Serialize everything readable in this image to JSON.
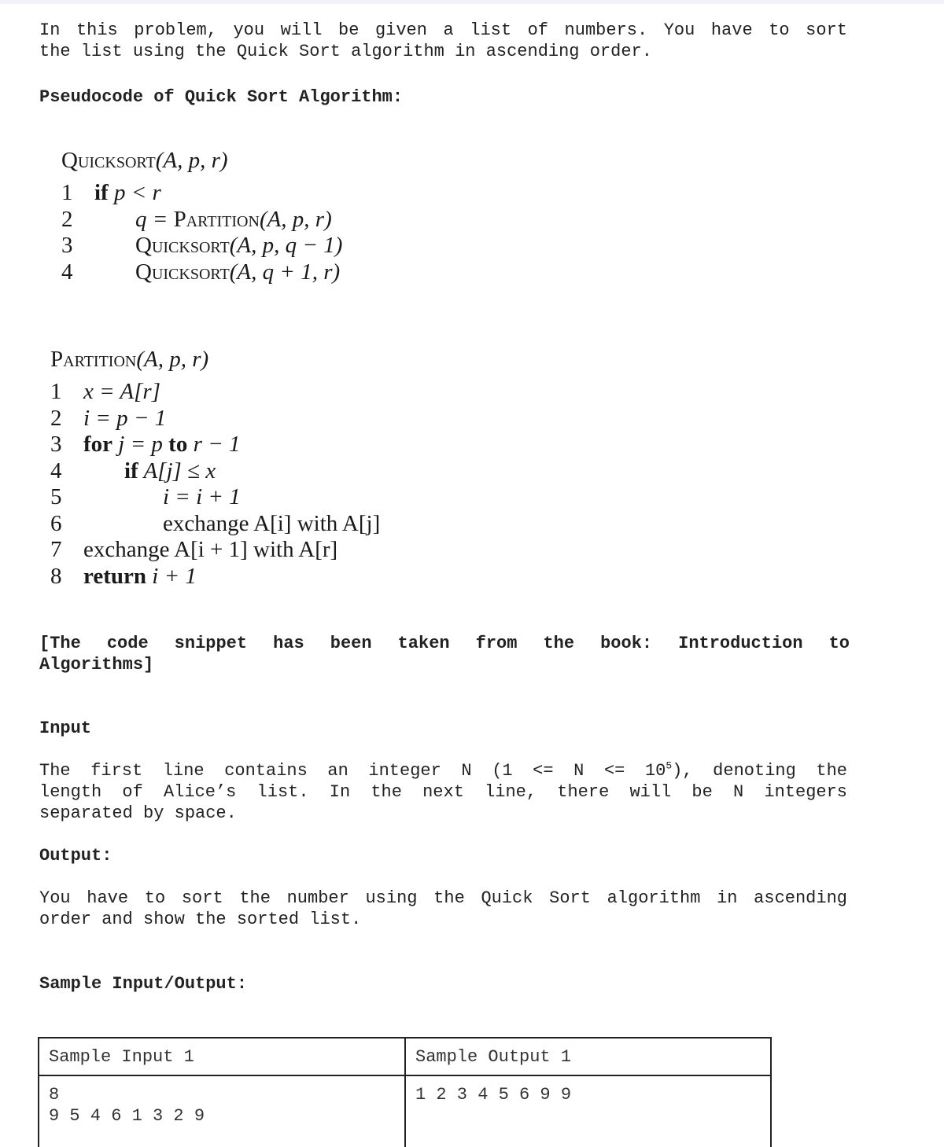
{
  "intro": {
    "line1": "In this problem, you will be given a list of numbers. You have to sort",
    "line2": "the list using the Quick Sort algorithm in ascending order."
  },
  "pseudocode_heading": "Pseudocode of Quick Sort Algorithm:",
  "quicksort": {
    "name": "Quicksort",
    "params": "(A, p, r)",
    "lines": [
      {
        "num": "1",
        "kw": "if",
        "text": " p < r"
      },
      {
        "num": "2",
        "text": "q = ",
        "call": "Partition",
        "args": "(A, p, r)"
      },
      {
        "num": "3",
        "call": "Quicksort",
        "args": "(A, p, q − 1)"
      },
      {
        "num": "4",
        "call": "Quicksort",
        "args": "(A, q + 1, r)"
      }
    ]
  },
  "partition": {
    "name": "Partition",
    "params": "(A, p, r)",
    "lines": [
      {
        "num": "1",
        "text": "x = A[r]"
      },
      {
        "num": "2",
        "text": "i = p − 1"
      },
      {
        "num": "3",
        "kw": "for",
        "text": " j = p ",
        "kw2": "to",
        "text2": " r − 1"
      },
      {
        "num": "4",
        "kw": "if",
        "text": " A[j] ≤ x"
      },
      {
        "num": "5",
        "text": "i = i + 1"
      },
      {
        "num": "6",
        "text": "exchange A[i] with A[j]"
      },
      {
        "num": "7",
        "text": "exchange A[i + 1] with A[r]"
      },
      {
        "num": "8",
        "kw": "return",
        "text": " i + 1"
      }
    ]
  },
  "citation": {
    "line1": "[The code snippet has been taken from the book: Introduction to",
    "line2": "Algorithms]"
  },
  "input_section": {
    "heading": "Input",
    "line1_a": "The first line contains an integer N (1 <= N <= 10",
    "line1_sup": "5",
    "line1_b": "), denoting the",
    "line2": "length of Alice’s list. In the next line, there will be N integers",
    "line3": "separated by space."
  },
  "output_section": {
    "heading": "Output:",
    "line1": "You have to sort the number using the Quick Sort algorithm in ascending",
    "line2": "order and show the sorted list."
  },
  "sample_heading": "Sample Input/Output:",
  "sample_table": {
    "headers": [
      "Sample Input 1",
      "Sample Output 1"
    ],
    "input": "8\n9 5 4 6 1 3 2 9",
    "output": "1 2 3 4 5 6 9 9"
  }
}
